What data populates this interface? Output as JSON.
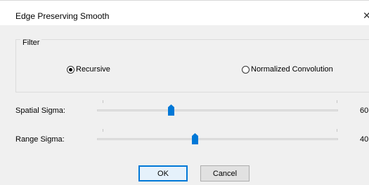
{
  "window": {
    "title": "Edge Preserving Smooth",
    "close_glyph": "✕"
  },
  "filter_group": {
    "legend": "Filter",
    "options": [
      {
        "label": "Recursive",
        "checked": true
      },
      {
        "label": "Normalized Convolution",
        "checked": false
      }
    ]
  },
  "sliders": [
    {
      "label": "Spatial Sigma:",
      "value": "60",
      "position_fraction": 0.3
    },
    {
      "label": "Range Sigma:",
      "value": "40",
      "position_fraction": 0.4
    }
  ],
  "buttons": {
    "ok": "OK",
    "cancel": "Cancel"
  },
  "colors": {
    "accent": "#0078d7",
    "client_bg": "#f0f0f0"
  }
}
